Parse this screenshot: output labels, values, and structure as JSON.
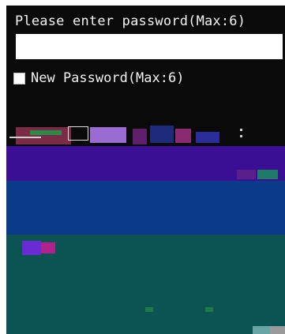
{
  "dialog": {
    "prompt": "Please enter password(Max:6)",
    "password_value": "",
    "new_password_label": "New Password(Max:6)",
    "new_password_checked": false
  },
  "colors": {
    "background": "#0a0a0a",
    "text": "#f2f2f2",
    "input_bg": "#ffffff",
    "glitch_purple": "#3a0f93",
    "glitch_blue": "#0b3a8a",
    "glitch_teal": "#0c5353"
  }
}
